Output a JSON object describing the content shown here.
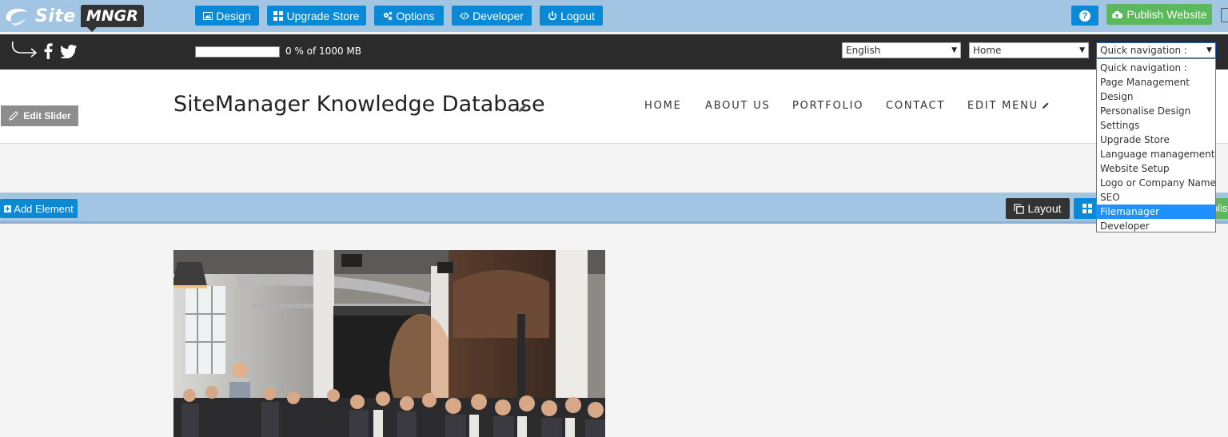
{
  "app": {
    "logo_site": "Site",
    "logo_mngr": "MNGR"
  },
  "toolbar": {
    "design": "Design",
    "upgrade_store": "Upgrade Store",
    "options": "Options",
    "developer": "Developer",
    "logout": "Logout",
    "help": "?",
    "publish": "Publish Website"
  },
  "storage": {
    "text": "0 % of 1000 MB",
    "used_percent": 0
  },
  "selects": {
    "language": "English",
    "page": "Home",
    "quick_nav": "Quick navigation :"
  },
  "quick_nav_options": [
    "Quick navigation :",
    "Page Management",
    "Design",
    "Personalise Design",
    "Settings",
    "Upgrade Store",
    "Language management",
    "Website Setup",
    "Logo or Company Name",
    "SEO",
    "Filemanager",
    "Developer"
  ],
  "quick_nav_selected_index": 10,
  "header": {
    "edit_slider": "Edit Slider",
    "site_title": "SiteManager Knowledge Database",
    "nav": [
      "HOME",
      "ABOUT US",
      "PORTFOLIO",
      "CONTACT",
      "EDIT MENU"
    ]
  },
  "element_bar": {
    "add_element": "Add Element",
    "layout": "Layout",
    "partial_publish": "olis"
  },
  "colors": {
    "topbar": "#a3c5e4",
    "button_blue": "#0a89d6",
    "publish_green": "#5cb85c",
    "dark_bar": "#2b2b2b"
  },
  "icons": {
    "design": "image-icon",
    "upgrade_store": "grid-icon",
    "options": "gears-icon",
    "developer": "code-icon",
    "logout": "power-icon",
    "publish": "cloud-upload-icon"
  }
}
